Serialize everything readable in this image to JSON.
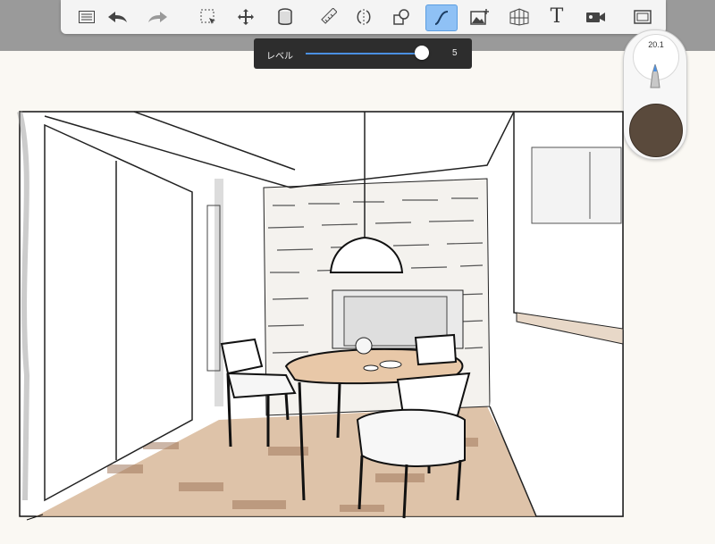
{
  "toolbar": {
    "tools": [
      {
        "name": "list-menu-icon"
      },
      {
        "name": "undo-icon"
      },
      {
        "name": "redo-icon"
      },
      {
        "name": "selection-icon"
      },
      {
        "name": "move-transform-icon"
      },
      {
        "name": "fill-bucket-icon"
      },
      {
        "name": "ruler-icon"
      },
      {
        "name": "symmetry-icon"
      },
      {
        "name": "shapes-icon"
      },
      {
        "name": "curve-stroke-icon",
        "active": true
      },
      {
        "name": "import-image-icon"
      },
      {
        "name": "perspective-grid-icon"
      },
      {
        "name": "text-tool-icon",
        "label": "T"
      },
      {
        "name": "record-video-icon"
      },
      {
        "name": "fullscreen-icon"
      }
    ]
  },
  "level_slider": {
    "label": "レベル",
    "value": "5",
    "fraction": 1.0
  },
  "brush": {
    "size_value": "20.1",
    "color": "#5a4a3c"
  },
  "colors": {
    "accent": "#8fc1f5",
    "slider_track": "#4a90e2",
    "toolbar_bg": "#f4f4f4",
    "canvas_bg": "#faf8f3"
  }
}
